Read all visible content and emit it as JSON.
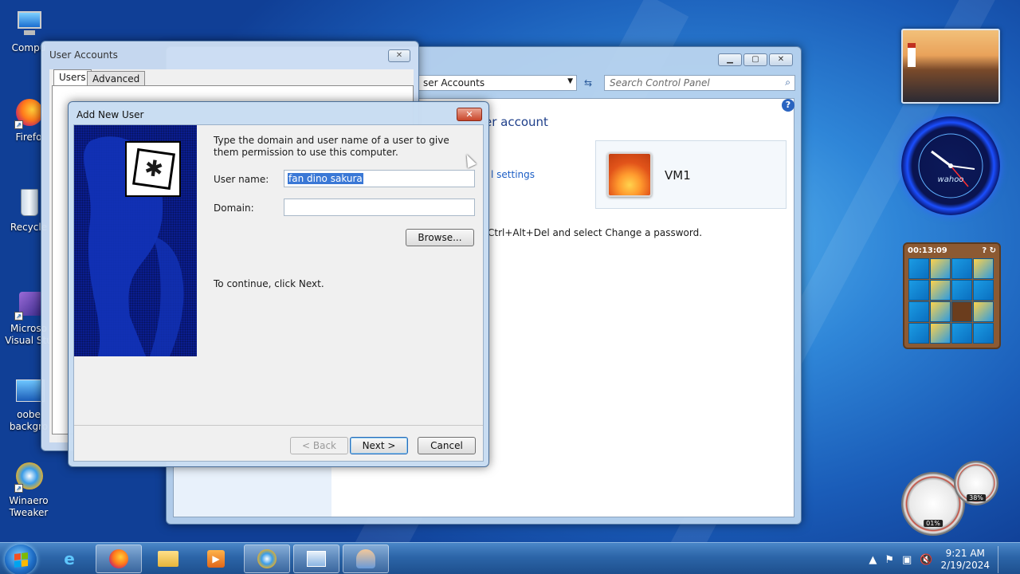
{
  "desktop": {
    "icons": [
      {
        "label": "Compu"
      },
      {
        "label": "Firefo"
      },
      {
        "label": "Recycle"
      },
      {
        "label": "Microso\nVisual Stu"
      },
      {
        "label": "oobe\nbackgro"
      },
      {
        "label": "Winaero\nTweaker"
      }
    ]
  },
  "gadgets": {
    "clock_brand": "wahoo",
    "puzzle_timer": "00:13:09",
    "cpu_percent": "01%",
    "mem_percent": "38%"
  },
  "control_panel": {
    "address": "ser Accounts",
    "search_placeholder": "Search Control Panel",
    "heading": "er account",
    "link": "l settings",
    "user_name": "VM1",
    "password_hint": "Ctrl+Alt+Del and select Change a password.",
    "help": "?"
  },
  "user_accounts": {
    "title": "User Accounts",
    "tabs": [
      {
        "label": "Users"
      },
      {
        "label": "Advanced"
      }
    ]
  },
  "add_new_user": {
    "title": "Add New User",
    "intro": "Type the domain and user name of a user to give them permission to use this computer.",
    "username_label": "User name:",
    "username_value": "fan dino sakura",
    "domain_label": "Domain:",
    "domain_value": "",
    "browse_label": "Browse...",
    "continue_text": "To continue, click Next.",
    "back_label": "< Back",
    "next_label": "Next >",
    "cancel_label": "Cancel"
  },
  "taskbar": {
    "time": "9:21 AM",
    "date": "2/19/2024"
  },
  "colors": {
    "desktop_blue": "#1d5fb8",
    "dialog_banner": "#0a1d8e",
    "selection": "#3a78d6",
    "close_red": "#c8452a"
  }
}
